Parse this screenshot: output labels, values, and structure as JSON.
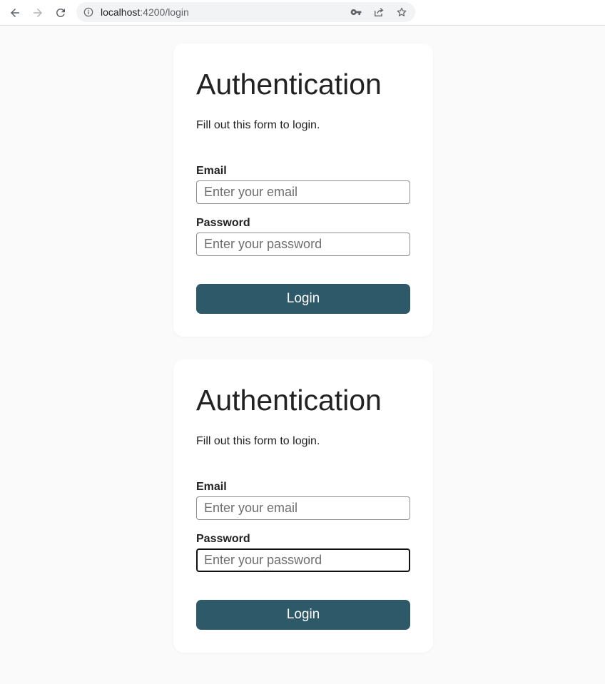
{
  "browser": {
    "url_host": "localhost",
    "url_port_path": ":4200/login",
    "icons": [
      "back-arrow-icon",
      "forward-arrow-icon",
      "reload-icon",
      "info-icon",
      "key-icon",
      "share-icon",
      "star-icon"
    ]
  },
  "cards": [
    {
      "title": "Authentication",
      "subtitle": "Fill out this form to login.",
      "email_label": "Email",
      "email_placeholder": "Enter your email",
      "email_value": "",
      "password_label": "Password",
      "password_placeholder": "Enter your password",
      "password_value": "",
      "login_label": "Login"
    },
    {
      "title": "Authentication",
      "subtitle": "Fill out this form to login.",
      "email_label": "Email",
      "email_placeholder": "Enter your email",
      "email_value": "",
      "password_label": "Password",
      "password_placeholder": "Enter your password",
      "password_value": "",
      "password_focused": true,
      "login_label": "Login"
    }
  ],
  "colors": {
    "page_background": "#fafafa",
    "card_background": "#ffffff",
    "button_background": "#2e5968",
    "button_text": "#ffffff"
  }
}
